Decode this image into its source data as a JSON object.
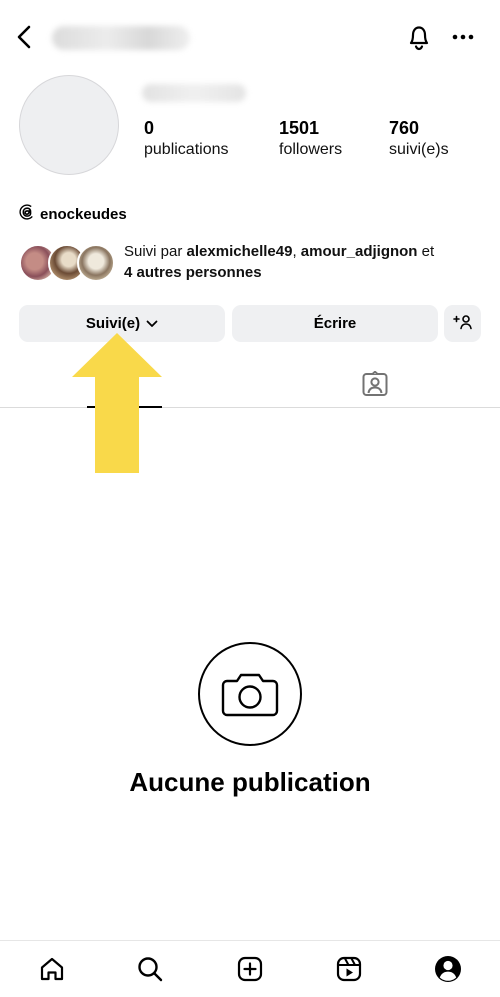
{
  "header": {
    "back_icon": "chevron-left-icon",
    "notifications_icon": "bell-icon",
    "more_icon": "more-horizontal-icon"
  },
  "profile": {
    "stats": [
      {
        "value": "0",
        "label": "publications"
      },
      {
        "value": "1501",
        "label": "followers"
      },
      {
        "value": "760",
        "label": "suivi(e)s"
      }
    ],
    "threads_handle": "enockeudes",
    "mutual": {
      "prefix": "Suivi par ",
      "user1": "alexmichelle49",
      "separator": ", ",
      "user2": "amour_adjignon",
      "conjunction": " et",
      "others": "4 autres personnes"
    }
  },
  "actions": {
    "follow_label": "Suivi(e)",
    "message_label": "Écrire",
    "suggest_icon": "add-person-icon"
  },
  "tabs": {
    "active": "grid",
    "items": [
      "grid-icon",
      "tagged-icon"
    ]
  },
  "empty_state": {
    "icon": "camera-icon",
    "title": "Aucune publication"
  },
  "bottom_nav": [
    "home-icon",
    "search-icon",
    "create-icon",
    "reels-icon",
    "profile-icon"
  ],
  "annotation": {
    "arrow_color": "#f9d94a",
    "points_to": "follow-button"
  }
}
